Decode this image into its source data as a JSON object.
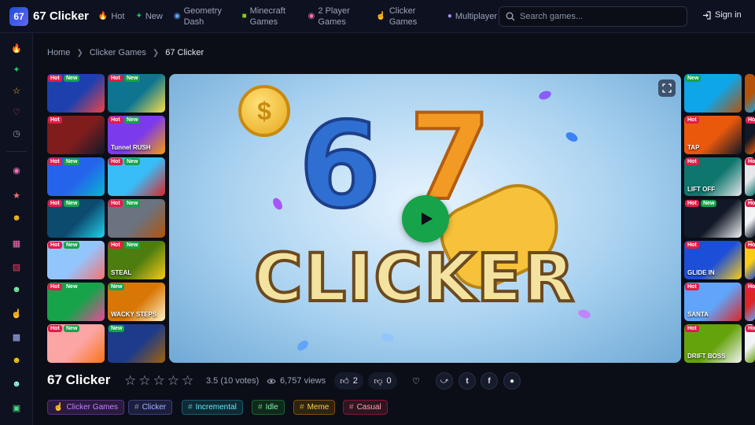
{
  "app": {
    "logo_mark": "67",
    "name": "67 Clicker"
  },
  "nav": [
    {
      "icon": "fire-icon",
      "label": "Hot"
    },
    {
      "icon": "sparkle-icon",
      "label": "New"
    },
    {
      "icon": "gamepad-icon",
      "label": "Geometry Dash"
    },
    {
      "icon": "block-icon",
      "label": "Minecraft Games"
    },
    {
      "icon": "gamepad-icon",
      "label": "2 Player Games"
    },
    {
      "icon": "cursor-icon",
      "label": "Clicker Games"
    },
    {
      "icon": "multiplayer-icon",
      "label": "Multiplayer"
    }
  ],
  "search": {
    "placeholder": "Search games..."
  },
  "signin": {
    "label": "Sign in"
  },
  "sidebar": [
    "fire-icon",
    "sparkle-icon",
    "star-icon",
    "heart-icon",
    "history-icon",
    "gamepad-icon",
    "star-icon",
    "smiley-icon",
    "block-icon",
    "car-icon",
    "smiley-icon",
    "cursor-icon",
    "multiplayer-icon",
    "smiley-icon",
    "smiley-icon",
    "block-icon"
  ],
  "breadcrumb": {
    "home": "Home",
    "category": "Clicker Games",
    "current": "67 Clicker"
  },
  "badges": {
    "hot": "Hot",
    "new": "New"
  },
  "left_thumbs": [
    {
      "hot": true,
      "new": true,
      "caption": "",
      "colors": [
        "#1e40af",
        "#ef4444"
      ]
    },
    {
      "hot": true,
      "new": true,
      "caption": "",
      "colors": [
        "#0e7490",
        "#fde047"
      ]
    },
    {
      "hot": true,
      "new": false,
      "caption": "",
      "colors": [
        "#7f1d1d",
        "#111827"
      ]
    },
    {
      "hot": true,
      "new": true,
      "caption": "Tunnel RUSH",
      "colors": [
        "#7c3aed",
        "#f59e0b"
      ]
    },
    {
      "hot": true,
      "new": true,
      "caption": "",
      "colors": [
        "#2563eb",
        "#06b6d4"
      ]
    },
    {
      "hot": true,
      "new": true,
      "caption": "",
      "colors": [
        "#38bdf8",
        "#dc2626"
      ]
    },
    {
      "hot": true,
      "new": true,
      "caption": "",
      "colors": [
        "#0c4a6e",
        "#22d3ee"
      ]
    },
    {
      "hot": true,
      "new": true,
      "caption": "",
      "colors": [
        "#6b7280",
        "#b45309"
      ]
    },
    {
      "hot": true,
      "new": true,
      "caption": "",
      "colors": [
        "#93c5fd",
        "#f87171"
      ]
    },
    {
      "hot": true,
      "new": true,
      "caption": "STEAL",
      "colors": [
        "#4d7c0f",
        "#facc15"
      ]
    },
    {
      "hot": true,
      "new": true,
      "caption": "",
      "colors": [
        "#16a34a",
        "#ec4899"
      ]
    },
    {
      "hot": false,
      "new": true,
      "caption": "WACKY STEPS",
      "colors": [
        "#d97706",
        "#fef3c7"
      ]
    },
    {
      "hot": true,
      "new": true,
      "caption": "",
      "colors": [
        "#fca5a5",
        "#f97316"
      ]
    },
    {
      "hot": false,
      "new": true,
      "caption": "",
      "colors": [
        "#1e3a8a",
        "#a16207"
      ]
    }
  ],
  "right_thumbs": [
    {
      "hot": false,
      "new": true,
      "caption": "",
      "colors": [
        "#0ea5e9",
        "#b45309"
      ]
    },
    {
      "hot": true,
      "new": false,
      "caption": "TAP",
      "colors": [
        "#ea580c",
        "#111827"
      ]
    },
    {
      "hot": true,
      "new": false,
      "caption": "LIFT OFF",
      "colors": [
        "#0f766e",
        "#e5e7eb"
      ]
    },
    {
      "hot": true,
      "new": true,
      "caption": "",
      "colors": [
        "#111827",
        "#f3f4f6"
      ]
    },
    {
      "hot": true,
      "new": false,
      "caption": "GLIDE IN",
      "colors": [
        "#1d4ed8",
        "#facc15"
      ]
    },
    {
      "hot": true,
      "new": false,
      "caption": "SANTA",
      "colors": [
        "#60a5fa",
        "#dc2626"
      ]
    },
    {
      "hot": true,
      "new": false,
      "caption": "DRIFT BOSS",
      "colors": [
        "#65a30d",
        "#f3f4f6"
      ]
    }
  ],
  "game": {
    "title": "67 Clicker",
    "art_six": "6",
    "art_seven": "7",
    "art_word": "CLICKER",
    "coin_mark": "$",
    "rating_text": "3.5 (10 votes)",
    "views_text": "6,757 views",
    "likes": "2",
    "dislikes": "0"
  },
  "tags": [
    {
      "label": "Clicker Games",
      "prefix": "cursor",
      "color": "#c084fc",
      "bg": "#2a1a3d",
      "border": "#5b2f86"
    },
    {
      "label": "Clicker",
      "prefix": "#",
      "color": "#a5b4fc",
      "bg": "#1c1f3b",
      "border": "#3b3f7a"
    },
    {
      "label": "Incremental",
      "prefix": "#",
      "color": "#67e8f9",
      "bg": "#0f2a33",
      "border": "#155e75"
    },
    {
      "label": "Idle",
      "prefix": "#",
      "color": "#86efac",
      "bg": "#10291a",
      "border": "#166534"
    },
    {
      "label": "Meme",
      "prefix": "#",
      "color": "#fcd34d",
      "bg": "#2e2410",
      "border": "#854d0e"
    },
    {
      "label": "Casual",
      "prefix": "#",
      "color": "#fda4af",
      "bg": "#301520",
      "border": "#881337"
    }
  ]
}
